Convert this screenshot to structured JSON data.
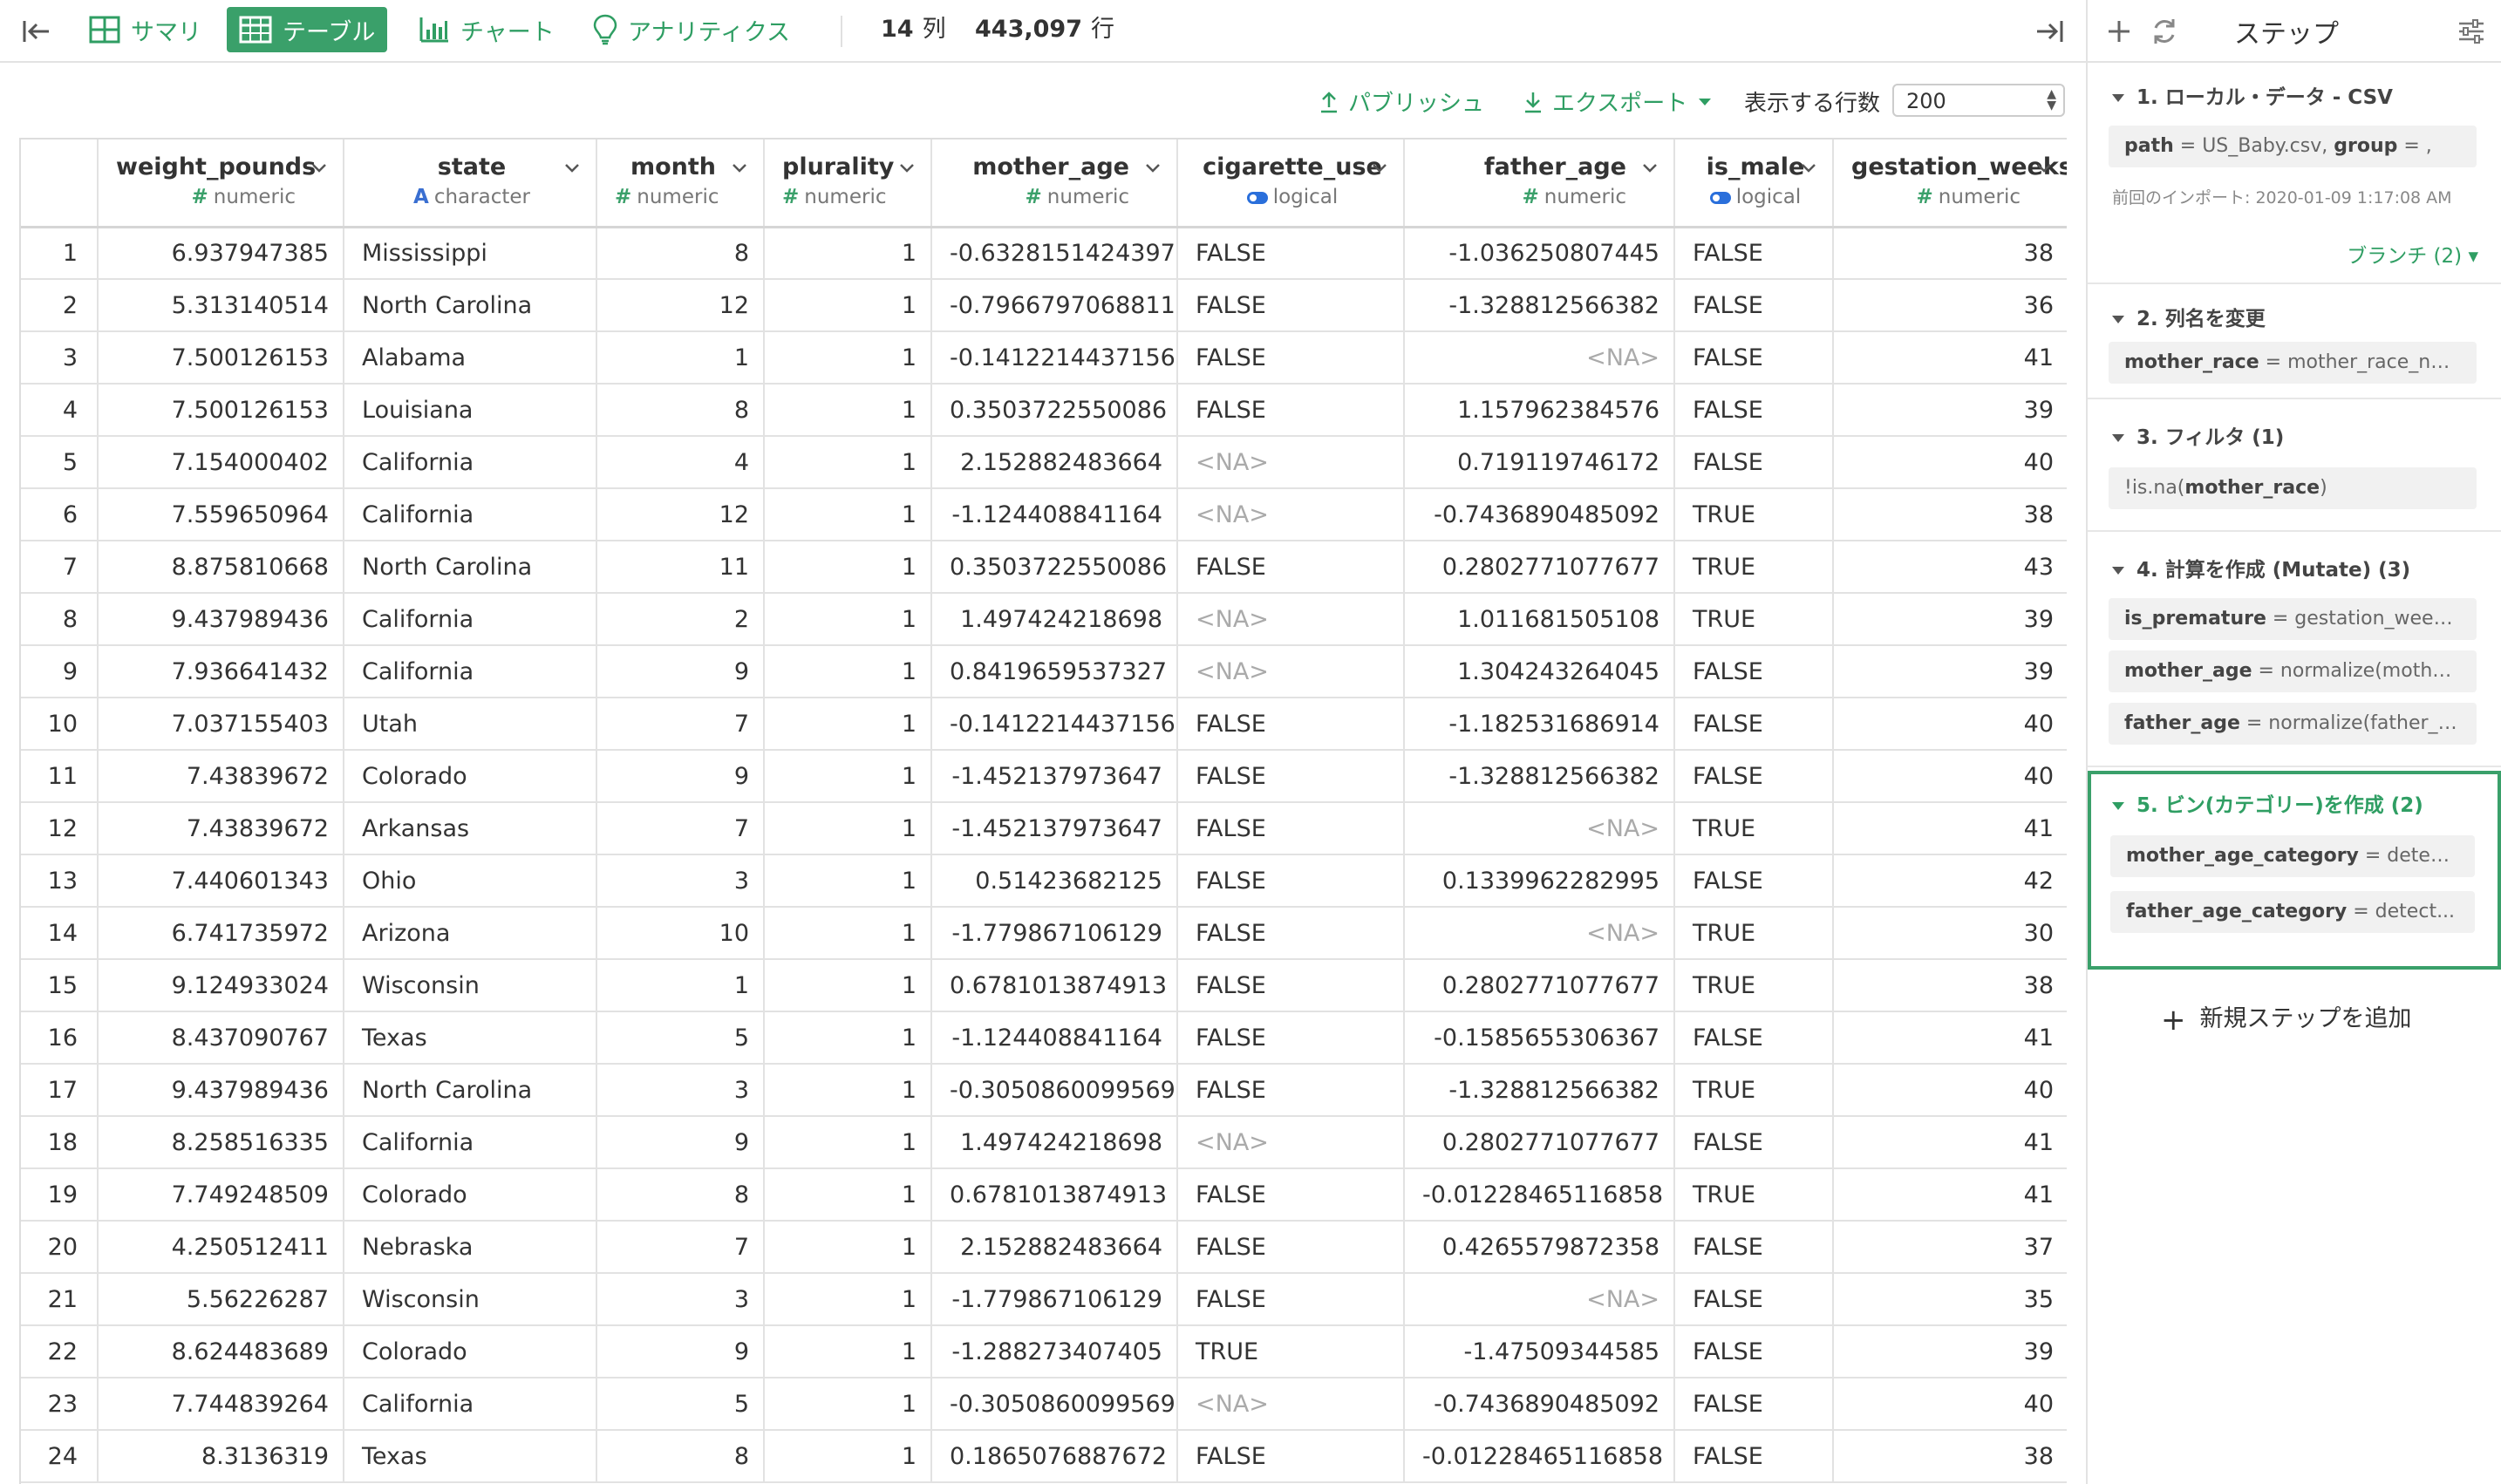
{
  "tabs": [
    {
      "label": "サマリ"
    },
    {
      "label": "テーブル"
    },
    {
      "label": "チャート"
    },
    {
      "label": "アナリティクス"
    }
  ],
  "summary": {
    "columns": "14",
    "columns_unit": "列",
    "rows": "443,097",
    "rows_unit": "行"
  },
  "toolbar": {
    "publish": "パブリッシュ",
    "export": "エクスポート",
    "rows_label": "表示する行数",
    "rows_value": "200"
  },
  "columns": [
    {
      "name": "weight_pounds",
      "type": "numeric"
    },
    {
      "name": "state",
      "type": "character"
    },
    {
      "name": "month",
      "type": "numeric"
    },
    {
      "name": "plurality",
      "type": "numeric"
    },
    {
      "name": "mother_age",
      "type": "numeric"
    },
    {
      "name": "cigarette_use",
      "type": "logical"
    },
    {
      "name": "father_age",
      "type": "numeric"
    },
    {
      "name": "is_male",
      "type": "logical"
    },
    {
      "name": "gestation_weeks",
      "type": "numeric"
    }
  ],
  "rows": [
    [
      "1",
      "6.937947385",
      "Mississippi",
      "8",
      "1",
      "-0.6328151424397",
      "FALSE",
      "-1.036250807445",
      "FALSE",
      "38"
    ],
    [
      "2",
      "5.313140514",
      "North Carolina",
      "12",
      "1",
      "-0.7966797068811",
      "FALSE",
      "-1.328812566382",
      "FALSE",
      "36"
    ],
    [
      "3",
      "7.500126153",
      "Alabama",
      "1",
      "1",
      "-0.1412214437156",
      "FALSE",
      "<NA>",
      "FALSE",
      "41"
    ],
    [
      "4",
      "7.500126153",
      "Louisiana",
      "8",
      "1",
      "0.3503722550086",
      "FALSE",
      "1.157962384576",
      "FALSE",
      "39"
    ],
    [
      "5",
      "7.154000402",
      "California",
      "4",
      "1",
      "2.152882483664",
      "<NA>",
      "0.719119746172",
      "FALSE",
      "40"
    ],
    [
      "6",
      "7.559650964",
      "California",
      "12",
      "1",
      "-1.124408841164",
      "<NA>",
      "-0.7436890485092",
      "TRUE",
      "38"
    ],
    [
      "7",
      "8.875810668",
      "North Carolina",
      "11",
      "1",
      "0.3503722550086",
      "FALSE",
      "0.2802771077677",
      "TRUE",
      "43"
    ],
    [
      "8",
      "9.437989436",
      "California",
      "2",
      "1",
      "1.497424218698",
      "<NA>",
      "1.011681505108",
      "TRUE",
      "39"
    ],
    [
      "9",
      "7.936641432",
      "California",
      "9",
      "1",
      "0.8419659537327",
      "<NA>",
      "1.304243264045",
      "FALSE",
      "39"
    ],
    [
      "10",
      "7.037155403",
      "Utah",
      "7",
      "1",
      "-0.1412214437156",
      "FALSE",
      "-1.182531686914",
      "FALSE",
      "40"
    ],
    [
      "11",
      "7.43839672",
      "Colorado",
      "9",
      "1",
      "-1.452137973647",
      "FALSE",
      "-1.328812566382",
      "FALSE",
      "40"
    ],
    [
      "12",
      "7.43839672",
      "Arkansas",
      "7",
      "1",
      "-1.452137973647",
      "FALSE",
      "<NA>",
      "TRUE",
      "41"
    ],
    [
      "13",
      "7.440601343",
      "Ohio",
      "3",
      "1",
      "0.51423682125",
      "FALSE",
      "0.1339962282995",
      "FALSE",
      "42"
    ],
    [
      "14",
      "6.741735972",
      "Arizona",
      "10",
      "1",
      "-1.779867106129",
      "FALSE",
      "<NA>",
      "TRUE",
      "30"
    ],
    [
      "15",
      "9.124933024",
      "Wisconsin",
      "1",
      "1",
      "0.6781013874913",
      "FALSE",
      "0.2802771077677",
      "TRUE",
      "38"
    ],
    [
      "16",
      "8.437090767",
      "Texas",
      "5",
      "1",
      "-1.124408841164",
      "FALSE",
      "-0.1585655306367",
      "FALSE",
      "41"
    ],
    [
      "17",
      "9.437989436",
      "North Carolina",
      "3",
      "1",
      "-0.3050860099569",
      "FALSE",
      "-1.328812566382",
      "TRUE",
      "40"
    ],
    [
      "18",
      "8.258516335",
      "California",
      "9",
      "1",
      "1.497424218698",
      "<NA>",
      "0.2802771077677",
      "FALSE",
      "41"
    ],
    [
      "19",
      "7.749248509",
      "Colorado",
      "8",
      "1",
      "0.6781013874913",
      "FALSE",
      "-0.01228465116858",
      "TRUE",
      "41"
    ],
    [
      "20",
      "4.250512411",
      "Nebraska",
      "7",
      "1",
      "2.152882483664",
      "FALSE",
      "0.4265579872358",
      "FALSE",
      "37"
    ],
    [
      "21",
      "5.56226287",
      "Wisconsin",
      "3",
      "1",
      "-1.779867106129",
      "FALSE",
      "<NA>",
      "FALSE",
      "35"
    ],
    [
      "22",
      "8.624483689",
      "Colorado",
      "9",
      "1",
      "-1.288273407405",
      "TRUE",
      "-1.47509344585",
      "FALSE",
      "39"
    ],
    [
      "23",
      "7.744839264",
      "California",
      "5",
      "1",
      "-0.3050860099569",
      "<NA>",
      "-0.7436890485092",
      "FALSE",
      "40"
    ],
    [
      "24",
      "8.3136319",
      "Texas",
      "8",
      "1",
      "0.1865076887672",
      "FALSE",
      "-0.01228465116858",
      "FALSE",
      "38"
    ]
  ],
  "panel": {
    "title": "ステップ",
    "steps": [
      {
        "title": "1. ローカル・データ - CSV",
        "pill_key": "path",
        "pill_mid": " = US_Baby.csv, ",
        "pill_key2": "group",
        "pill_rest": " = ,",
        "meta": "前回のインポート: 2020-01-09 1:17:08 AM",
        "branch": "ブランチ (2)"
      },
      {
        "title": "2. 列名を変更",
        "pill_key": "mother_race",
        "pill_rest": " = mother_race_name..."
      },
      {
        "title": "3. フィルタ (1)",
        "pill_pre": "!is.na(",
        "pill_key": "mother_race",
        "pill_rest": ")"
      },
      {
        "title": "4. 計算を作成 (Mutate) (3)",
        "items": [
          {
            "key": "is_premature",
            "rest": " = gestation_week..."
          },
          {
            "key": "mother_age",
            "rest": " = normalize(mothe..."
          },
          {
            "key": "father_age",
            "rest": " = normalize(father_a..."
          }
        ]
      },
      {
        "title": "5. ビン(カテゴリー)を作成 (2)",
        "items": [
          {
            "key": "mother_age_category",
            "rest": " = detec..."
          },
          {
            "key": "father_age_category",
            "rest": " = detect..."
          }
        ]
      }
    ],
    "add_step": "新規ステップを追加"
  }
}
